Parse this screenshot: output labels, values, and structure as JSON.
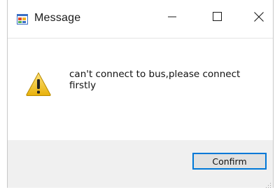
{
  "window": {
    "title": "Message",
    "title_icon": "app-window-icon"
  },
  "title_controls": {
    "minimize_icon": "minimize-icon",
    "maximize_icon": "maximize-icon",
    "close_icon": "close-icon"
  },
  "dialog": {
    "icon": "warning-icon",
    "message": "can't connect to bus,please connect firstly"
  },
  "footer": {
    "confirm_label": "Confirm"
  },
  "colors": {
    "accent": "#0078d7",
    "footer_bg": "#f0f0f0",
    "warning_yellow": "#f2c811"
  }
}
